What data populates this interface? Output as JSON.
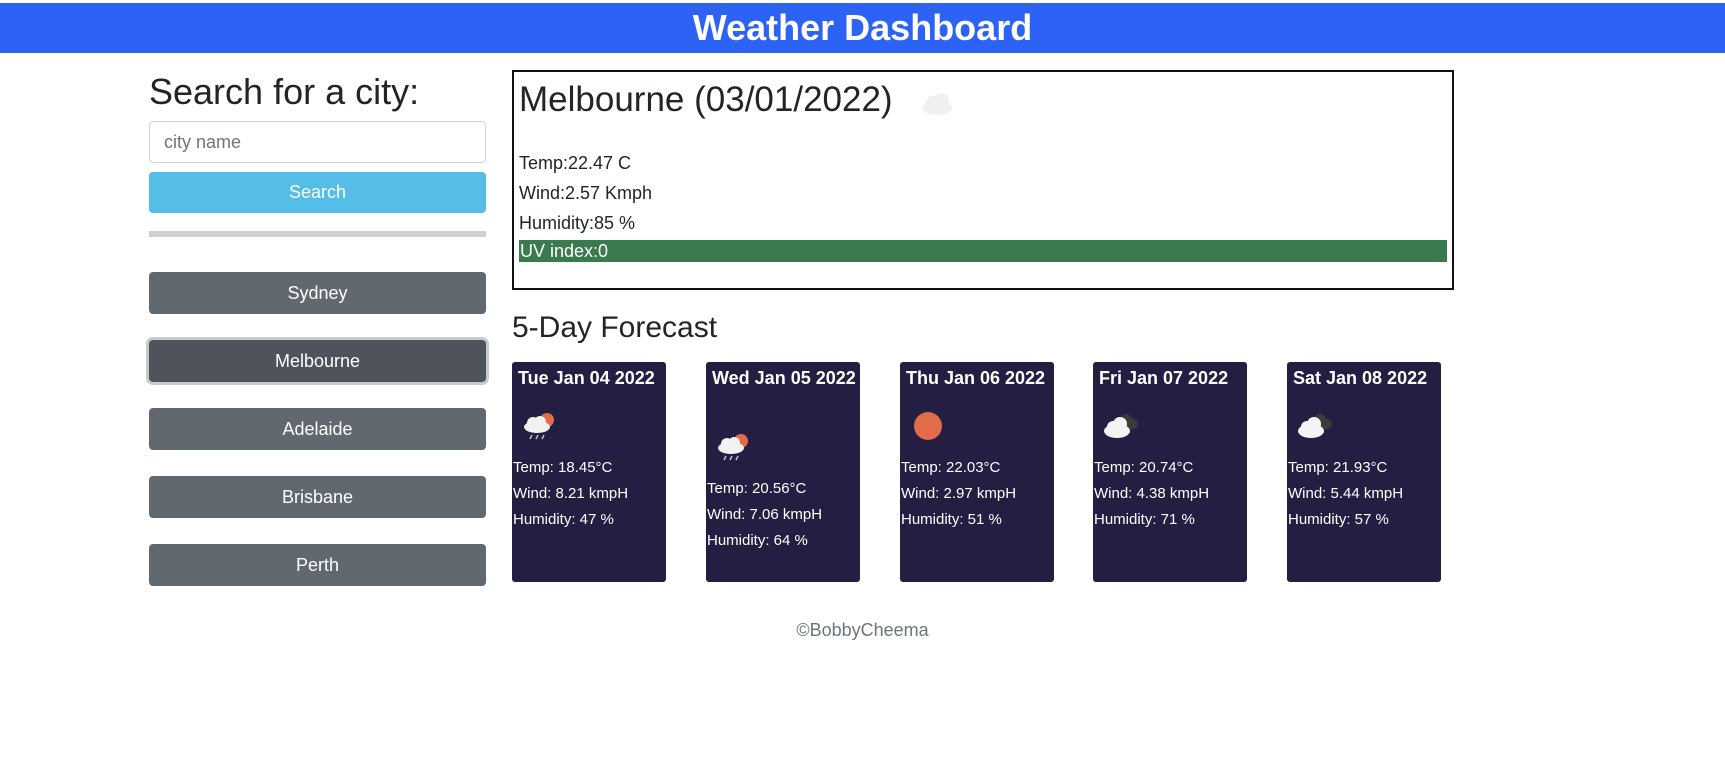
{
  "header": {
    "title": "Weather Dashboard"
  },
  "search": {
    "heading": "Search for a city:",
    "placeholder": "city name",
    "button_label": "Search"
  },
  "history": [
    {
      "label": "Sydney",
      "active": false
    },
    {
      "label": "Melbourne",
      "active": true
    },
    {
      "label": "Adelaide",
      "active": false
    },
    {
      "label": "Brisbane",
      "active": false
    },
    {
      "label": "Perth",
      "active": false
    }
  ],
  "current": {
    "title": "Melbourne (03/01/2022)",
    "icon": "cloud-icon",
    "temp": "Temp:22.47 C",
    "wind": "Wind:2.57 Kmph",
    "humidity": "Humidity:85 %",
    "uv": "UV index:0",
    "uv_color": "#3a7a4f"
  },
  "forecast": {
    "heading": "5-Day Forecast",
    "days": [
      {
        "date": "Tue Jan 04 2022",
        "icon": "rain-sun-icon",
        "temp": "Temp: 18.45°C",
        "wind": "Wind: 8.21 kmpH",
        "humidity": "Humidity: 47 %"
      },
      {
        "date": "Wed Jan 05 2022",
        "icon": "rain-sun-icon",
        "temp": "Temp: 20.56°C",
        "wind": "Wind: 7.06 kmpH",
        "humidity": "Humidity: 64 %"
      },
      {
        "date": "Thu Jan 06 2022",
        "icon": "sun-icon",
        "temp": "Temp: 22.03°C",
        "wind": "Wind: 2.97 kmpH",
        "humidity": "Humidity: 51 %"
      },
      {
        "date": "Fri Jan 07 2022",
        "icon": "broken-clouds-icon",
        "temp": "Temp: 20.74°C",
        "wind": "Wind: 4.38 kmpH",
        "humidity": "Humidity: 71 %"
      },
      {
        "date": "Sat Jan 08 2022",
        "icon": "broken-clouds-icon",
        "temp": "Temp: 21.93°C",
        "wind": "Wind: 5.44 kmpH",
        "humidity": "Humidity: 57 %"
      }
    ]
  },
  "colors": {
    "header_bg": "#2d63f5",
    "search_button": "#54bde8",
    "history_button": "#626870",
    "card_bg": "#231e42"
  },
  "footer": {
    "text": "©BobbyCheema"
  }
}
